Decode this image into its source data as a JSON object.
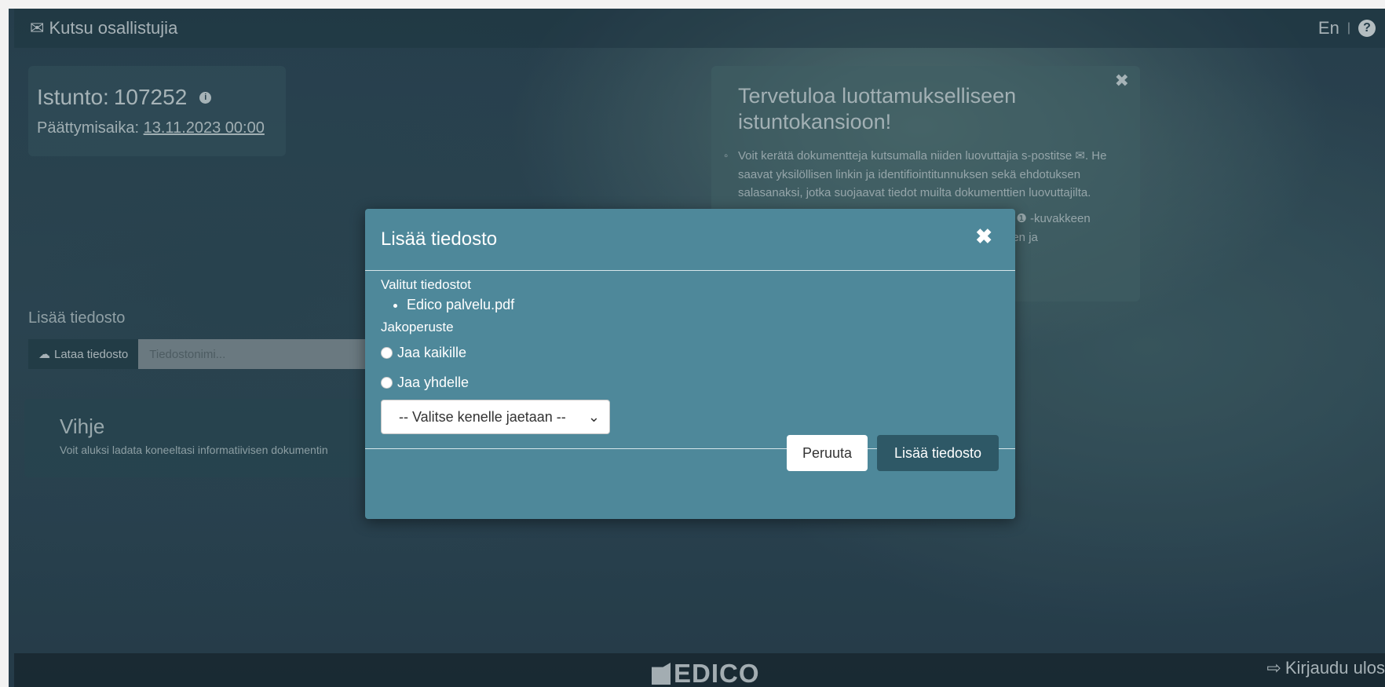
{
  "topbar": {
    "title": "Kutsu osallistujia",
    "lang": "En",
    "separator": "|",
    "help_icon": "question-circle-icon",
    "mail_icon": "envelope-icon"
  },
  "session": {
    "label": "Istunto:",
    "id": "107252",
    "end_label": "Päättymisaika:",
    "end_value": "13.11.2023 00:00"
  },
  "welcome": {
    "title": "Tervetuloa luottamukselliseen istuntokansioon!",
    "paragraph": "Voit kerätä dokumentteja kutsumalla niiden luovuttajia s-postitse ✉. He saavat yksilöllisen linkin ja identifiointitunnuksen sekä ehdotuksen salasanaksi, jotka suojaavat tiedot muilta dokumenttien luovuttajilta.",
    "paragraph2_fragment1": "van ❶ -kuvakkeen",
    "paragraph2_fragment2": "uksen ja"
  },
  "upload": {
    "section_label": "Lisää tiedosto",
    "button_label": "Lataa tiedosto",
    "placeholder": "Tiedostonimi..."
  },
  "hint": {
    "title": "Vihje",
    "text": "Voit aluksi ladata koneeltasi informatiivisen dokumentin"
  },
  "footer": {
    "logo": "EDICO",
    "logout": "Kirjaudu ulos"
  },
  "modal": {
    "title": "Lisää tiedosto",
    "selected_label": "Valitut tiedostot",
    "files": [
      "Edico palvelu.pdf"
    ],
    "sharing_label": "Jakoperuste",
    "option_all": "Jaa kaikille",
    "option_one": "Jaa yhdelle",
    "select_value": "-- Valitse kenelle jaetaan --",
    "cancel": "Peruuta",
    "submit": "Lisää tiedosto"
  }
}
